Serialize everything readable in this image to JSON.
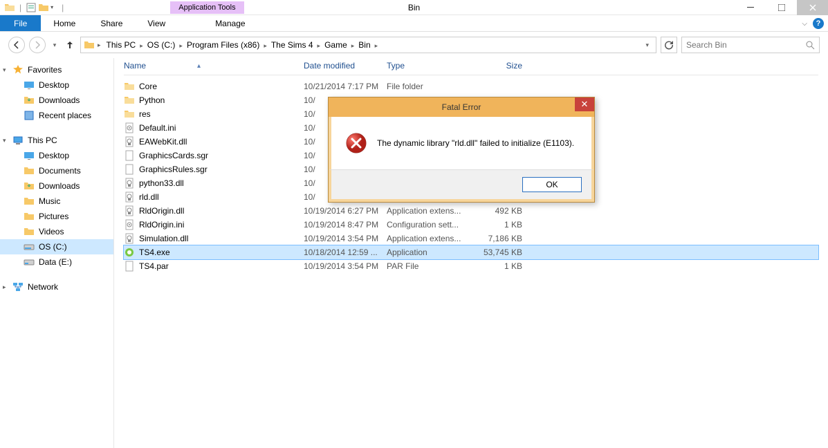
{
  "window": {
    "title": "Bin"
  },
  "apptools": {
    "label": "Application Tools"
  },
  "ribbon": {
    "file": "File",
    "home": "Home",
    "share": "Share",
    "view": "View",
    "manage": "Manage"
  },
  "breadcrumb": {
    "segments": [
      "This PC",
      "OS (C:)",
      "Program Files (x86)",
      "The Sims 4",
      "Game",
      "Bin"
    ]
  },
  "search": {
    "placeholder": "Search Bin"
  },
  "sidebar": {
    "favorites": {
      "label": "Favorites",
      "items": [
        "Desktop",
        "Downloads",
        "Recent places"
      ]
    },
    "thispc": {
      "label": "This PC",
      "items": [
        "Desktop",
        "Documents",
        "Downloads",
        "Music",
        "Pictures",
        "Videos",
        "OS (C:)",
        "Data (E:)"
      ],
      "selectedIndex": 6
    },
    "network": {
      "label": "Network"
    }
  },
  "columns": {
    "name": "Name",
    "date": "Date modified",
    "type": "Type",
    "size": "Size"
  },
  "files": [
    {
      "icon": "folder",
      "name": "Core",
      "date": "10/21/2014 7:17 PM",
      "type": "File folder",
      "size": ""
    },
    {
      "icon": "folder",
      "name": "Python",
      "date": "10/",
      "type": "",
      "size": ""
    },
    {
      "icon": "folder",
      "name": "res",
      "date": "10/",
      "type": "",
      "size": ""
    },
    {
      "icon": "ini",
      "name": "Default.ini",
      "date": "10/",
      "type": "",
      "size": ""
    },
    {
      "icon": "dll",
      "name": "EAWebKit.dll",
      "date": "10/",
      "type": "",
      "size": ""
    },
    {
      "icon": "file",
      "name": "GraphicsCards.sgr",
      "date": "10/",
      "type": "",
      "size": ""
    },
    {
      "icon": "file",
      "name": "GraphicsRules.sgr",
      "date": "10/",
      "type": "",
      "size": ""
    },
    {
      "icon": "dll",
      "name": "python33.dll",
      "date": "10/",
      "type": "",
      "size": ""
    },
    {
      "icon": "dll",
      "name": "rld.dll",
      "date": "10/",
      "type": "",
      "size": ""
    },
    {
      "icon": "dll",
      "name": "RldOrigin.dll",
      "date": "10/19/2014 6:27 PM",
      "type": "Application extens...",
      "size": "492 KB"
    },
    {
      "icon": "ini",
      "name": "RldOrigin.ini",
      "date": "10/19/2014 8:47 PM",
      "type": "Configuration sett...",
      "size": "1 KB"
    },
    {
      "icon": "dll",
      "name": "Simulation.dll",
      "date": "10/19/2014 3:54 PM",
      "type": "Application extens...",
      "size": "7,186 KB"
    },
    {
      "icon": "exe",
      "name": "TS4.exe",
      "date": "10/18/2014 12:59 ...",
      "type": "Application",
      "size": "53,745 KB",
      "selected": true
    },
    {
      "icon": "file",
      "name": "TS4.par",
      "date": "10/19/2014 3:54 PM",
      "type": "PAR File",
      "size": "1 KB"
    }
  ],
  "dialog": {
    "title": "Fatal Error",
    "message": "The dynamic library \"rld.dll\" failed to initialize (E1103).",
    "ok": "OK"
  }
}
